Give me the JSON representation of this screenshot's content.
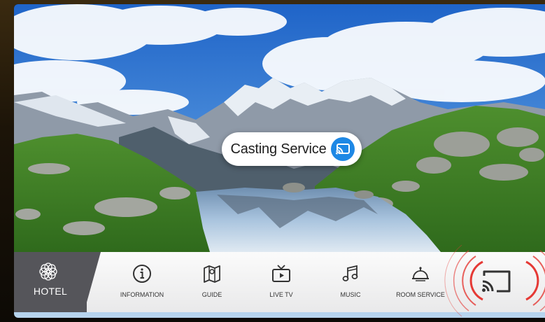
{
  "popup": {
    "label": "Casting Service",
    "icon": "cast-icon",
    "accent": "#1e88e5"
  },
  "hotel": {
    "label": "HOTEL",
    "icon": "lotus-logo-icon",
    "bg": "#55555a"
  },
  "nav": [
    {
      "label": "INFORMATION",
      "icon": "info-icon"
    },
    {
      "label": "GUIDE",
      "icon": "map-icon"
    },
    {
      "label": "LIVE TV",
      "icon": "tv-icon"
    },
    {
      "label": "MUSIC",
      "icon": "music-note-icon"
    },
    {
      "label": "ROOM SERVICE",
      "icon": "room-service-bell-icon"
    }
  ],
  "cast_button": {
    "icon": "cast-icon",
    "highlight": "#e53935"
  }
}
